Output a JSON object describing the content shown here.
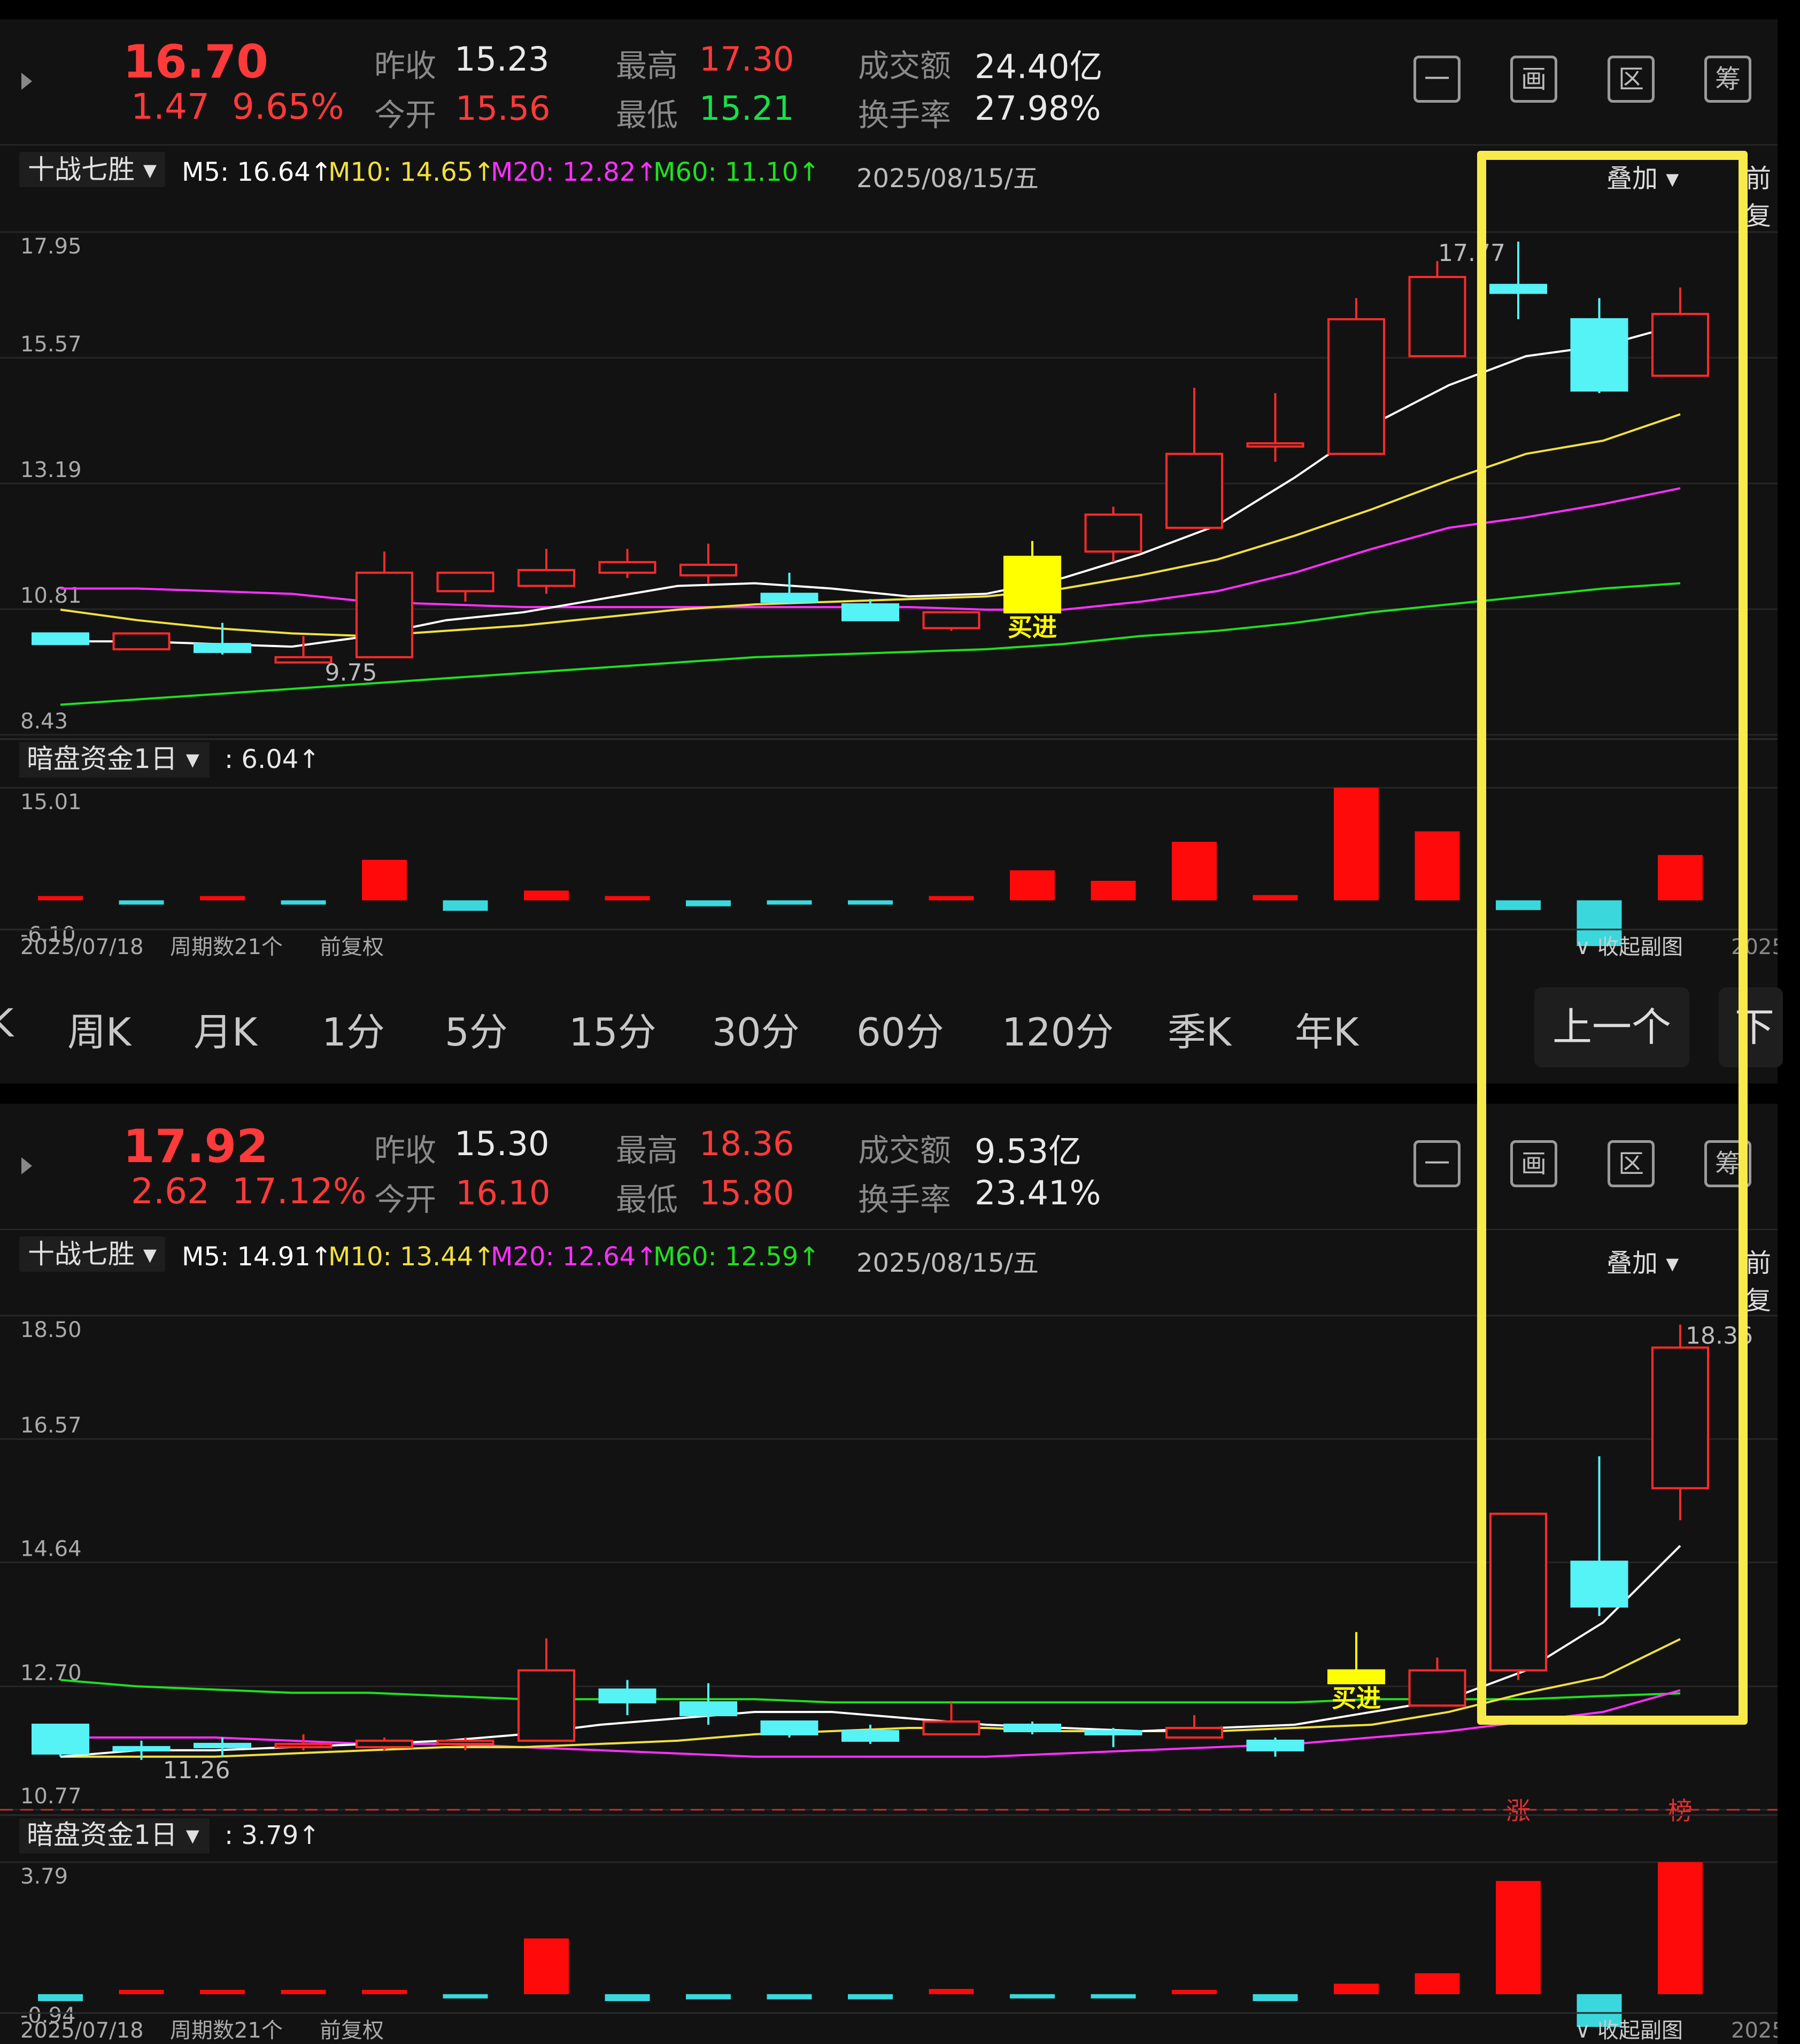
{
  "panels": [
    {
      "quote": {
        "price": "16.70",
        "change": "1.47",
        "change_pct": "9.65%",
        "prev_close_label": "昨收",
        "prev_close": "15.23",
        "open_label": "今开",
        "open": "15.56",
        "high_label": "最高",
        "high": "17.30",
        "low_label": "最低",
        "low": "15.21",
        "amount_label": "成交额",
        "amount": "24.40亿",
        "turnover_label": "换手率",
        "turnover": "27.98%"
      },
      "icons": [
        "minus-icon",
        "draw-icon",
        "region-icon",
        "chips-icon"
      ],
      "icon_glyphs": [
        "一",
        "画",
        "区",
        "筹"
      ],
      "indicator": "十战七胜",
      "ma": {
        "m5": "M5: 16.64↑",
        "m10": "M10: 14.65↑",
        "m20": "M20: 12.82↑",
        "m60": "M60: 11.10↑"
      },
      "date": "2025/08/15/五",
      "overlay": "叠加",
      "prev_right": "前复",
      "sub_indicator": "暗盘资金1日",
      "sub_value": ": 6.04↑",
      "footer": {
        "start": "2025/07/18",
        "count": "周期数21个",
        "adj": "前复权",
        "collapse": "收起副图",
        "end": "2025"
      },
      "tabs": [
        "K",
        "周K",
        "月K",
        "1分",
        "5分",
        "15分",
        "30分",
        "60分",
        "120分",
        "季K",
        "年K"
      ],
      "prev_btn": "上一个",
      "next_btn": "下一"
    },
    {
      "quote": {
        "price": "17.92",
        "change": "2.62",
        "change_pct": "17.12%",
        "prev_close_label": "昨收",
        "prev_close": "15.30",
        "open_label": "今开",
        "open": "16.10",
        "high_label": "最高",
        "high": "18.36",
        "low_label": "最低",
        "low": "15.80",
        "amount_label": "成交额",
        "amount": "9.53亿",
        "turnover_label": "换手率",
        "turnover": "23.41%"
      },
      "icons": [
        "minus-icon",
        "draw-icon",
        "region-icon",
        "chips-icon"
      ],
      "icon_glyphs": [
        "一",
        "画",
        "区",
        "筹"
      ],
      "indicator": "十战七胜",
      "ma": {
        "m5": "M5: 14.91↑",
        "m10": "M10: 13.44↑",
        "m20": "M20: 12.64↑",
        "m60": "M60: 12.59↑"
      },
      "date": "2025/08/15/五",
      "overlay": "叠加",
      "prev_right": "前复",
      "sub_indicator": "暗盘资金1日",
      "sub_value": ": 3.79↑",
      "footer": {
        "start": "2025/07/18",
        "count": "周期数21个",
        "adj": "前复权",
        "collapse": "收起副图",
        "end": "2025"
      }
    }
  ],
  "colors": {
    "up": "#ff2a2a",
    "down": "#55f2f6",
    "m5": "#ffffff",
    "m10": "#f0e040",
    "m20": "#ff30ff",
    "m60": "#20e020",
    "signal": "#ffff00",
    "highlight": "#f8ea4a"
  },
  "chart_data": [
    {
      "type": "candlestick",
      "y_ticks": [
        "17.95",
        "15.57",
        "13.19",
        "10.81",
        "8.43"
      ],
      "ylim": [
        8.43,
        17.95
      ],
      "candles": [
        {
          "o": 10.35,
          "c": 10.15,
          "h": 10.35,
          "l": 10.15
        },
        {
          "o": 10.05,
          "c": 10.35,
          "h": 10.35,
          "l": 10.05
        },
        {
          "o": 10.15,
          "c": 10.0,
          "h": 10.55,
          "l": 9.95
        },
        {
          "o": 9.8,
          "c": 9.9,
          "h": 10.3,
          "l": 9.8
        },
        {
          "o": 9.9,
          "c": 11.5,
          "h": 11.9,
          "l": 9.9
        },
        {
          "o": 11.15,
          "c": 11.5,
          "h": 11.5,
          "l": 10.95
        },
        {
          "o": 11.25,
          "c": 11.55,
          "h": 11.95,
          "l": 11.1
        },
        {
          "o": 11.5,
          "c": 11.7,
          "h": 11.95,
          "l": 11.4
        },
        {
          "o": 11.45,
          "c": 11.65,
          "h": 12.05,
          "l": 11.3
        },
        {
          "o": 11.1,
          "c": 10.95,
          "h": 11.5,
          "l": 10.9
        },
        {
          "o": 10.9,
          "c": 10.6,
          "h": 11.0,
          "l": 10.6
        },
        {
          "o": 10.45,
          "c": 10.75,
          "h": 10.75,
          "l": 10.4
        },
        {
          "o": 10.75,
          "c": 11.8,
          "h": 12.1,
          "l": 10.8,
          "signal": "买进"
        },
        {
          "o": 11.9,
          "c": 12.6,
          "h": 12.75,
          "l": 11.7
        },
        {
          "o": 12.35,
          "c": 13.75,
          "h": 15.0,
          "l": 12.35
        },
        {
          "o": 13.95,
          "c": 13.95,
          "h": 14.9,
          "l": 13.6
        },
        {
          "o": 13.75,
          "c": 16.3,
          "h": 16.7,
          "l": 13.75
        },
        {
          "o": 15.6,
          "c": 17.1,
          "h": 17.4,
          "l": 15.6
        },
        {
          "o": 16.95,
          "c": 16.8,
          "h": 17.77,
          "l": 16.3
        },
        {
          "o": 16.3,
          "c": 14.95,
          "h": 16.7,
          "l": 14.9
        },
        {
          "o": 15.23,
          "c": 16.4,
          "h": 16.9,
          "l": 15.21
        }
      ],
      "labels": {
        "low_mark": "9.75",
        "high_mark": "17.77"
      },
      "ma5": [
        10.2,
        10.2,
        10.15,
        10.1,
        10.3,
        10.6,
        10.75,
        11.0,
        11.25,
        11.3,
        11.2,
        11.05,
        11.1,
        11.4,
        11.85,
        12.4,
        13.3,
        14.3,
        15.05,
        15.6,
        15.8,
        16.2
      ],
      "ma10": [
        10.8,
        10.6,
        10.45,
        10.35,
        10.3,
        10.4,
        10.5,
        10.65,
        10.8,
        10.9,
        10.95,
        11.0,
        11.05,
        11.2,
        11.45,
        11.75,
        12.2,
        12.7,
        13.25,
        13.75,
        14.0,
        14.5
      ],
      "ma20": [
        11.2,
        11.2,
        11.15,
        11.1,
        10.95,
        10.9,
        10.85,
        10.85,
        10.85,
        10.85,
        10.85,
        10.85,
        10.8,
        10.8,
        10.95,
        11.15,
        11.5,
        11.95,
        12.35,
        12.55,
        12.8,
        13.1
      ],
      "ma60": [
        9.0,
        9.1,
        9.2,
        9.3,
        9.4,
        9.5,
        9.6,
        9.7,
        9.8,
        9.9,
        9.95,
        10.0,
        10.05,
        10.15,
        10.3,
        10.4,
        10.55,
        10.75,
        10.9,
        11.05,
        11.2,
        11.3
      ],
      "sub": {
        "y_ticks": [
          "15.01",
          "-6.10"
        ],
        "ylim": [
          -6.1,
          15.01
        ],
        "values": [
          0.3,
          -0.5,
          0.3,
          -0.3,
          5.4,
          -1.4,
          1.3,
          0.5,
          -0.8,
          -0.5,
          -0.5,
          0.5,
          4.0,
          2.6,
          7.8,
          0.7,
          15.01,
          9.2,
          -1.3,
          -6.1,
          6.04
        ]
      }
    },
    {
      "type": "candlestick",
      "y_ticks": [
        "18.50",
        "16.57",
        "14.64",
        "12.70",
        "10.77"
      ],
      "ylim": [
        10.77,
        18.5
      ],
      "candles": [
        {
          "o": 12.1,
          "c": 11.65,
          "h": 12.1,
          "l": 11.6
        },
        {
          "o": 11.75,
          "c": 11.7,
          "h": 11.85,
          "l": 11.55
        },
        {
          "o": 11.8,
          "c": 11.75,
          "h": 11.9,
          "l": 11.6
        },
        {
          "o": 11.75,
          "c": 11.8,
          "h": 11.95,
          "l": 11.7
        },
        {
          "o": 11.75,
          "c": 11.85,
          "h": 11.9,
          "l": 11.7
        },
        {
          "o": 11.8,
          "c": 11.85,
          "h": 11.9,
          "l": 11.7
        },
        {
          "o": 11.85,
          "c": 12.95,
          "h": 13.45,
          "l": 11.85
        },
        {
          "o": 12.65,
          "c": 12.45,
          "h": 12.8,
          "l": 12.25
        },
        {
          "o": 12.45,
          "c": 12.25,
          "h": 12.75,
          "l": 12.1
        },
        {
          "o": 12.15,
          "c": 11.95,
          "h": 12.15,
          "l": 11.9
        },
        {
          "o": 12.0,
          "c": 11.85,
          "h": 12.1,
          "l": 11.8
        },
        {
          "o": 11.95,
          "c": 12.15,
          "h": 12.45,
          "l": 11.95
        },
        {
          "o": 12.1,
          "c": 12.0,
          "h": 12.15,
          "l": 11.95
        },
        {
          "o": 12.0,
          "c": 11.95,
          "h": 12.05,
          "l": 11.75
        },
        {
          "o": 11.9,
          "c": 12.05,
          "h": 12.25,
          "l": 11.9
        },
        {
          "o": 11.85,
          "c": 11.7,
          "h": 11.9,
          "l": 11.6
        },
        {
          "o": 12.75,
          "c": 12.95,
          "h": 13.55,
          "l": 12.75,
          "signal": "买进"
        },
        {
          "o": 12.4,
          "c": 12.95,
          "h": 13.15,
          "l": 12.4
        },
        {
          "o": 12.95,
          "c": 15.4,
          "h": 15.4,
          "l": 12.8
        },
        {
          "o": 14.65,
          "c": 13.95,
          "h": 16.3,
          "l": 13.8
        },
        {
          "o": 15.8,
          "c": 18.0,
          "h": 18.36,
          "l": 15.3
        }
      ],
      "labels": {
        "low_mark": "11.26",
        "high_mark": "18.36"
      },
      "badges": [
        "涨",
        "榜"
      ],
      "ma5": [
        11.6,
        11.7,
        11.7,
        11.75,
        11.8,
        11.85,
        11.95,
        12.1,
        12.2,
        12.3,
        12.3,
        12.2,
        12.1,
        12.05,
        12.0,
        12.05,
        12.1,
        12.3,
        12.5,
        12.95,
        13.7,
        14.9
      ],
      "ma10": [
        11.6,
        11.6,
        11.6,
        11.65,
        11.7,
        11.75,
        11.75,
        11.8,
        11.85,
        11.95,
        12.0,
        12.05,
        12.05,
        12.0,
        12.0,
        12.0,
        12.05,
        12.1,
        12.3,
        12.6,
        12.85,
        13.44
      ],
      "ma20": [
        11.9,
        11.9,
        11.9,
        11.85,
        11.8,
        11.8,
        11.75,
        11.7,
        11.65,
        11.6,
        11.6,
        11.6,
        11.6,
        11.65,
        11.7,
        11.75,
        11.8,
        11.9,
        12.0,
        12.15,
        12.3,
        12.64
      ],
      "ma60": [
        12.8,
        12.7,
        12.65,
        12.6,
        12.6,
        12.55,
        12.5,
        12.5,
        12.5,
        12.5,
        12.45,
        12.45,
        12.45,
        12.45,
        12.45,
        12.45,
        12.45,
        12.5,
        12.5,
        12.5,
        12.55,
        12.59
      ],
      "sub": {
        "y_ticks": [
          "3.79",
          "-0.94"
        ],
        "ylim": [
          -0.94,
          3.79
        ],
        "values": [
          -0.2,
          0.05,
          0.05,
          0.05,
          0.05,
          -0.05,
          1.6,
          -0.2,
          -0.15,
          -0.15,
          -0.15,
          0.15,
          -0.05,
          -0.05,
          0.05,
          -0.2,
          0.3,
          0.6,
          3.25,
          -0.94,
          3.79
        ]
      }
    }
  ]
}
